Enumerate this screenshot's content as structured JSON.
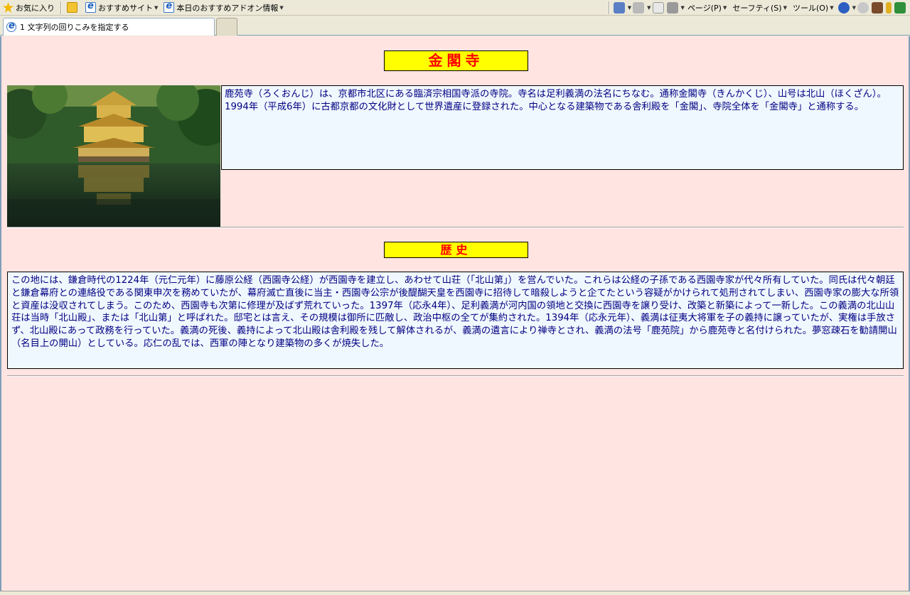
{
  "command_bar": {
    "favorites_label": "お気に入り",
    "suggested_sites_label": "おすすめサイト",
    "addons_label": "本日のおすすめアドオン情報",
    "page_menu_label": "ページ(P)",
    "safety_menu_label": "セーフティ(S)",
    "tools_menu_label": "ツール(O)",
    "help_icon": "help-icon",
    "home_icon": "home-icon",
    "feeds_icon": "rss-feed-icon",
    "mail_icon": "mail-icon",
    "print_icon": "print-icon"
  },
  "tab": {
    "title": "1 文字列の回りこみを指定する"
  },
  "page": {
    "title": "金閣寺",
    "description": "鹿苑寺（ろくおんじ）は、京都市北区にある臨済宗相国寺派の寺院。寺名は足利義満の法名にちなむ。通称金閣寺（きんかくじ）、山号は北山（ほくざん）。1994年（平成6年）に古都京都の文化財として世界遺産に登録された。中心となる建築物である舎利殿を「金閣」、寺院全体を「金閣寺」と通称する。",
    "history_heading": "歴史",
    "history_text": "この地には、鎌倉時代の1224年（元仁元年）に藤原公経（西園寺公経）が西園寺を建立し、あわせて山荘（「北山第」）を営んでいた。これらは公経の子孫である西園寺家が代々所有していた。同氏は代々朝廷と鎌倉幕府との連絡役である関東申次を務めていたが、幕府滅亡直後に当主・西園寺公宗が後醍醐天皇を西園寺に招待して暗殺しようと企てたという容疑がかけられて処刑されてしまい、西園寺家の膨大な所領と資産は没収されてしまう。このため、西園寺も次第に修理が及ばず荒れていった。1397年（応永4年）、足利義満が河内国の領地と交換に西園寺を譲り受け、改築と新築によって一新した。この義満の北山山荘は当時「北山殿」、または「北山第」と呼ばれた。邸宅とは言え、その規模は御所に匹敵し、政治中枢の全てが集約された。1394年（応永元年）、義満は征夷大将軍を子の義持に譲っていたが、実権は手放さず、北山殿にあって政務を行っていた。義満の死後、義持によって北山殿は舎利殿を残して解体されるが、義満の遺言により禅寺とされ、義満の法号「鹿苑院」から鹿苑寺と名付けられた。夢窓疎石を勧請開山（名目上の開山）としている。応仁の乱では、西軍の陣となり建築物の多くが焼失した。"
  },
  "colors": {
    "page_background": "#ffe4e1",
    "heading_background": "#ffff00",
    "heading_text": "#ff0000",
    "box_background": "#f0f8ff",
    "box_text": "#000080"
  }
}
